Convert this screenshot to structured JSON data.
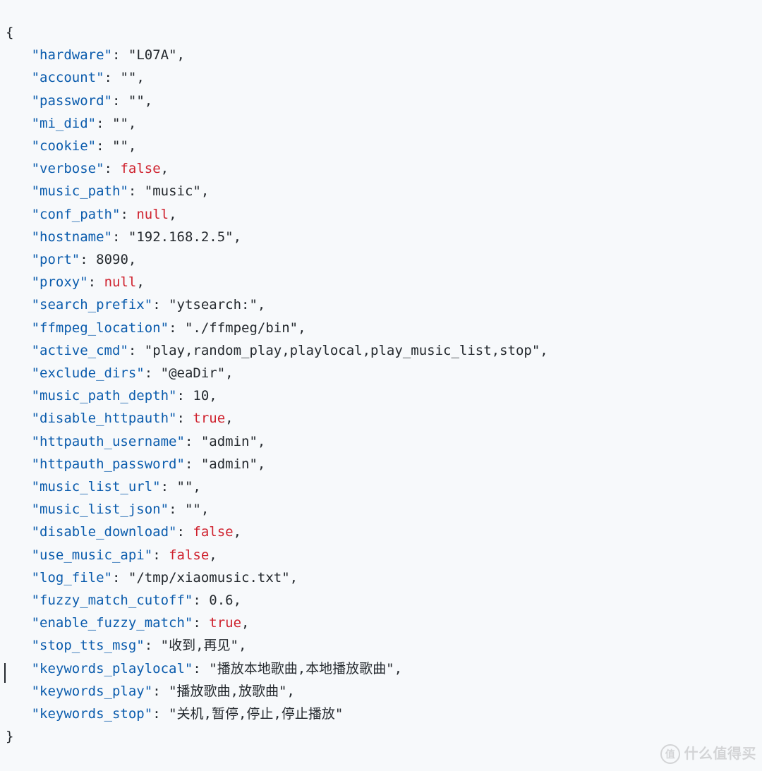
{
  "config_entries": [
    {
      "key": "hardware",
      "value": "L07A",
      "type": "string"
    },
    {
      "key": "account",
      "value": "",
      "type": "string"
    },
    {
      "key": "password",
      "value": "",
      "type": "string"
    },
    {
      "key": "mi_did",
      "value": "",
      "type": "string"
    },
    {
      "key": "cookie",
      "value": "",
      "type": "string"
    },
    {
      "key": "verbose",
      "value": "false",
      "type": "false"
    },
    {
      "key": "music_path",
      "value": "music",
      "type": "string"
    },
    {
      "key": "conf_path",
      "value": "null",
      "type": "null"
    },
    {
      "key": "hostname",
      "value": "192.168.2.5",
      "type": "string"
    },
    {
      "key": "port",
      "value": "8090",
      "type": "number"
    },
    {
      "key": "proxy",
      "value": "null",
      "type": "null"
    },
    {
      "key": "search_prefix",
      "value": "ytsearch:",
      "type": "string"
    },
    {
      "key": "ffmpeg_location",
      "value": "./ffmpeg/bin",
      "type": "string"
    },
    {
      "key": "active_cmd",
      "value": "play,random_play,playlocal,play_music_list,stop",
      "type": "string"
    },
    {
      "key": "exclude_dirs",
      "value": "@eaDir",
      "type": "string"
    },
    {
      "key": "music_path_depth",
      "value": "10",
      "type": "number"
    },
    {
      "key": "disable_httpauth",
      "value": "true",
      "type": "true"
    },
    {
      "key": "httpauth_username",
      "value": "admin",
      "type": "string"
    },
    {
      "key": "httpauth_password",
      "value": "admin",
      "type": "string"
    },
    {
      "key": "music_list_url",
      "value": "",
      "type": "string"
    },
    {
      "key": "music_list_json",
      "value": "",
      "type": "string"
    },
    {
      "key": "disable_download",
      "value": "false",
      "type": "false"
    },
    {
      "key": "use_music_api",
      "value": "false",
      "type": "false"
    },
    {
      "key": "log_file",
      "value": "/tmp/xiaomusic.txt",
      "type": "string"
    },
    {
      "key": "fuzzy_match_cutoff",
      "value": "0.6",
      "type": "number"
    },
    {
      "key": "enable_fuzzy_match",
      "value": "true",
      "type": "true"
    },
    {
      "key": "stop_tts_msg",
      "value": "收到,再见",
      "type": "string"
    },
    {
      "key": "keywords_playlocal",
      "value": "播放本地歌曲,本地播放歌曲",
      "type": "string"
    },
    {
      "key": "keywords_play",
      "value": "播放歌曲,放歌曲",
      "type": "string"
    },
    {
      "key": "keywords_stop",
      "value": "关机,暂停,停止,停止播放",
      "type": "string",
      "last": true
    }
  ],
  "brace_open": "{",
  "brace_close": "}",
  "watermark": {
    "badge": "值",
    "text": "什么值得买"
  }
}
